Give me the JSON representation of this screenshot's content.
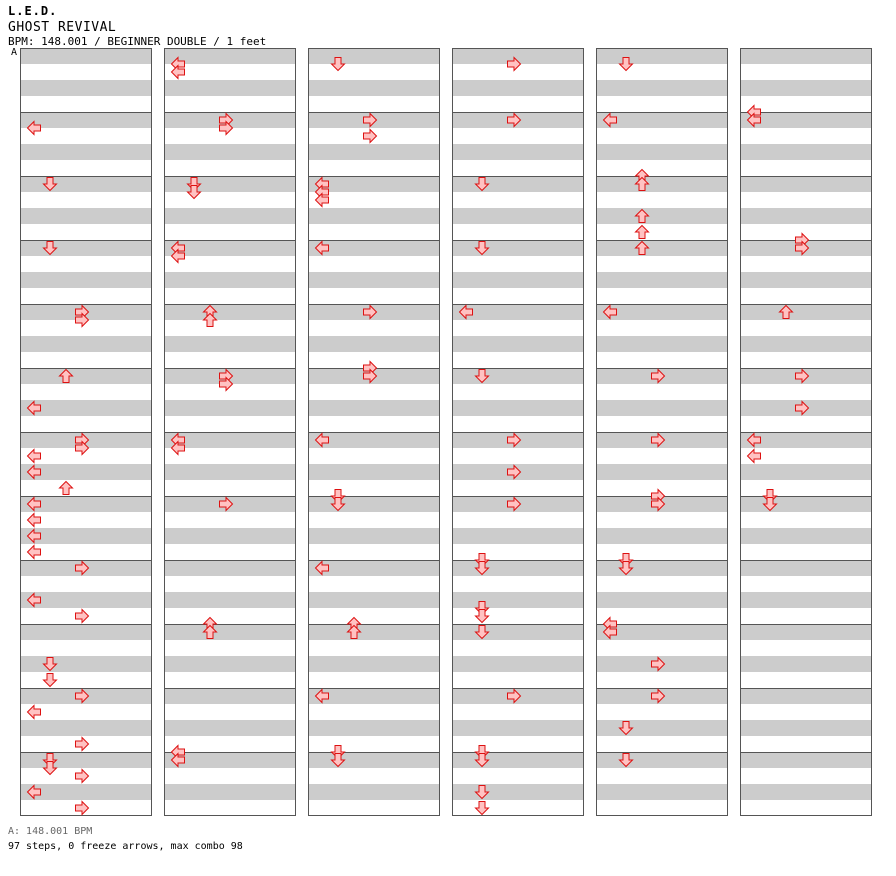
{
  "song": {
    "artist": "L.E.D.",
    "title": "GHOST REVIVAL",
    "info": "BPM: 148.001 / BEGINNER DOUBLE / 1 feet"
  },
  "markers": {
    "bpm_marker_label": "A"
  },
  "footer": {
    "bpm_line": "A: 148.001 BPM",
    "stats": "97 steps, 0 freeze arrows, max combo 98"
  },
  "colors": {
    "stripe": "#cccccc",
    "lane_border": "#555555",
    "arrow_fill": "#ffc2c2",
    "arrow_stroke": "#dd1111",
    "bpm_line": "#4a90d9"
  },
  "chart_data": {
    "type": "step-chart",
    "columns": 6,
    "measures_per_column": 12,
    "rows_per_measure": 4,
    "lanes": [
      "left",
      "down",
      "up",
      "right",
      "left",
      "down",
      "up",
      "right"
    ],
    "notes": [
      {
        "c": 0,
        "r": 4.5,
        "d": "left"
      },
      {
        "c": 0,
        "r": 8,
        "d": "down"
      },
      {
        "c": 0,
        "r": 12,
        "d": "down"
      },
      {
        "c": 0,
        "r": 16,
        "d": "right"
      },
      {
        "c": 0,
        "r": 16.5,
        "d": "right"
      },
      {
        "c": 0,
        "r": 20,
        "d": "up"
      },
      {
        "c": 0,
        "r": 22,
        "d": "left"
      },
      {
        "c": 0,
        "r": 24,
        "d": "right"
      },
      {
        "c": 0,
        "r": 24.5,
        "d": "right"
      },
      {
        "c": 0,
        "r": 25,
        "d": "left"
      },
      {
        "c": 0,
        "r": 26,
        "d": "left"
      },
      {
        "c": 0,
        "r": 27,
        "d": "up"
      },
      {
        "c": 0,
        "r": 28,
        "d": "left"
      },
      {
        "c": 0,
        "r": 29,
        "d": "left"
      },
      {
        "c": 0,
        "r": 30,
        "d": "left"
      },
      {
        "c": 0,
        "r": 31,
        "d": "left"
      },
      {
        "c": 0,
        "r": 32,
        "d": "right"
      },
      {
        "c": 0,
        "r": 34,
        "d": "left"
      },
      {
        "c": 0,
        "r": 35,
        "d": "right"
      },
      {
        "c": 0,
        "r": 38,
        "d": "down"
      },
      {
        "c": 0,
        "r": 39,
        "d": "down"
      },
      {
        "c": 0,
        "r": 40,
        "d": "right"
      },
      {
        "c": 0,
        "r": 41,
        "d": "left"
      },
      {
        "c": 0,
        "r": 43,
        "d": "right"
      },
      {
        "c": 0,
        "r": 44,
        "d": "down"
      },
      {
        "c": 0,
        "r": 44.5,
        "d": "down"
      },
      {
        "c": 0,
        "r": 45,
        "d": "right"
      },
      {
        "c": 0,
        "r": 46,
        "d": "left"
      },
      {
        "c": 0,
        "r": 47,
        "d": "right"
      },
      {
        "c": 1,
        "r": 0.5,
        "d": "left"
      },
      {
        "c": 1,
        "r": 1,
        "d": "left"
      },
      {
        "c": 1,
        "r": 4,
        "d": "right"
      },
      {
        "c": 1,
        "r": 4.5,
        "d": "right"
      },
      {
        "c": 1,
        "r": 8,
        "d": "down"
      },
      {
        "c": 1,
        "r": 8.5,
        "d": "down"
      },
      {
        "c": 1,
        "r": 12,
        "d": "left"
      },
      {
        "c": 1,
        "r": 12.5,
        "d": "left"
      },
      {
        "c": 1,
        "r": 16,
        "d": "up"
      },
      {
        "c": 1,
        "r": 16.5,
        "d": "up"
      },
      {
        "c": 1,
        "r": 20,
        "d": "right"
      },
      {
        "c": 1,
        "r": 20.5,
        "d": "right"
      },
      {
        "c": 1,
        "r": 24,
        "d": "left"
      },
      {
        "c": 1,
        "r": 24.5,
        "d": "left"
      },
      {
        "c": 1,
        "r": 28,
        "d": "right"
      },
      {
        "c": 1,
        "r": 35.5,
        "d": "up"
      },
      {
        "c": 1,
        "r": 36,
        "d": "up"
      },
      {
        "c": 1,
        "r": 43.5,
        "d": "left"
      },
      {
        "c": 1,
        "r": 44,
        "d": "left"
      },
      {
        "c": 2,
        "r": 0.5,
        "d": "down"
      },
      {
        "c": 2,
        "r": 4,
        "d": "right"
      },
      {
        "c": 2,
        "r": 5,
        "d": "right"
      },
      {
        "c": 2,
        "r": 8,
        "d": "left"
      },
      {
        "c": 2,
        "r": 8.5,
        "d": "left"
      },
      {
        "c": 2,
        "r": 9,
        "d": "left"
      },
      {
        "c": 2,
        "r": 12,
        "d": "left"
      },
      {
        "c": 2,
        "r": 16,
        "d": "right"
      },
      {
        "c": 2,
        "r": 19.5,
        "d": "right"
      },
      {
        "c": 2,
        "r": 20,
        "d": "right"
      },
      {
        "c": 2,
        "r": 24,
        "d": "left"
      },
      {
        "c": 2,
        "r": 27.5,
        "d": "down"
      },
      {
        "c": 2,
        "r": 28,
        "d": "down"
      },
      {
        "c": 2,
        "r": 32,
        "d": "left"
      },
      {
        "c": 2,
        "r": 35.5,
        "d": "up"
      },
      {
        "c": 2,
        "r": 36,
        "d": "up"
      },
      {
        "c": 2,
        "r": 40,
        "d": "left"
      },
      {
        "c": 2,
        "r": 43.5,
        "d": "down"
      },
      {
        "c": 2,
        "r": 44,
        "d": "down"
      },
      {
        "c": 3,
        "r": 0.5,
        "d": "right"
      },
      {
        "c": 3,
        "r": 4,
        "d": "right"
      },
      {
        "c": 3,
        "r": 8,
        "d": "down"
      },
      {
        "c": 3,
        "r": 12,
        "d": "down"
      },
      {
        "c": 3,
        "r": 16,
        "d": "left"
      },
      {
        "c": 3,
        "r": 20,
        "d": "down"
      },
      {
        "c": 3,
        "r": 24,
        "d": "right"
      },
      {
        "c": 3,
        "r": 26,
        "d": "right"
      },
      {
        "c": 3,
        "r": 28,
        "d": "right"
      },
      {
        "c": 3,
        "r": 31.5,
        "d": "down"
      },
      {
        "c": 3,
        "r": 32,
        "d": "down"
      },
      {
        "c": 3,
        "r": 34.5,
        "d": "down"
      },
      {
        "c": 3,
        "r": 35,
        "d": "down"
      },
      {
        "c": 3,
        "r": 36,
        "d": "down"
      },
      {
        "c": 3,
        "r": 40,
        "d": "right"
      },
      {
        "c": 3,
        "r": 43.5,
        "d": "down"
      },
      {
        "c": 3,
        "r": 44,
        "d": "down"
      },
      {
        "c": 3,
        "r": 46,
        "d": "down"
      },
      {
        "c": 3,
        "r": 47,
        "d": "down"
      },
      {
        "c": 4,
        "r": 0.5,
        "d": "down"
      },
      {
        "c": 4,
        "r": 4,
        "d": "left"
      },
      {
        "c": 4,
        "r": 7.5,
        "d": "up"
      },
      {
        "c": 4,
        "r": 8,
        "d": "up"
      },
      {
        "c": 4,
        "r": 10,
        "d": "up"
      },
      {
        "c": 4,
        "r": 11,
        "d": "up"
      },
      {
        "c": 4,
        "r": 12,
        "d": "up"
      },
      {
        "c": 4,
        "r": 16,
        "d": "left"
      },
      {
        "c": 4,
        "r": 20,
        "d": "right"
      },
      {
        "c": 4,
        "r": 24,
        "d": "right"
      },
      {
        "c": 4,
        "r": 27.5,
        "d": "right"
      },
      {
        "c": 4,
        "r": 28,
        "d": "right"
      },
      {
        "c": 4,
        "r": 31.5,
        "d": "down"
      },
      {
        "c": 4,
        "r": 32,
        "d": "down"
      },
      {
        "c": 4,
        "r": 35.5,
        "d": "left"
      },
      {
        "c": 4,
        "r": 36,
        "d": "left"
      },
      {
        "c": 4,
        "r": 38,
        "d": "right"
      },
      {
        "c": 4,
        "r": 40,
        "d": "right"
      },
      {
        "c": 4,
        "r": 42,
        "d": "down"
      },
      {
        "c": 4,
        "r": 44,
        "d": "down"
      },
      {
        "c": 5,
        "r": 3.5,
        "d": "left"
      },
      {
        "c": 5,
        "r": 4,
        "d": "left"
      },
      {
        "c": 5,
        "r": 11.5,
        "d": "right"
      },
      {
        "c": 5,
        "r": 12,
        "d": "right"
      },
      {
        "c": 5,
        "r": 16,
        "d": "up"
      },
      {
        "c": 5,
        "r": 20,
        "d": "right"
      },
      {
        "c": 5,
        "r": 22,
        "d": "right"
      },
      {
        "c": 5,
        "r": 24,
        "d": "left"
      },
      {
        "c": 5,
        "r": 25,
        "d": "left"
      },
      {
        "c": 5,
        "r": 27.5,
        "d": "down"
      },
      {
        "c": 5,
        "r": 28,
        "d": "down"
      }
    ]
  }
}
